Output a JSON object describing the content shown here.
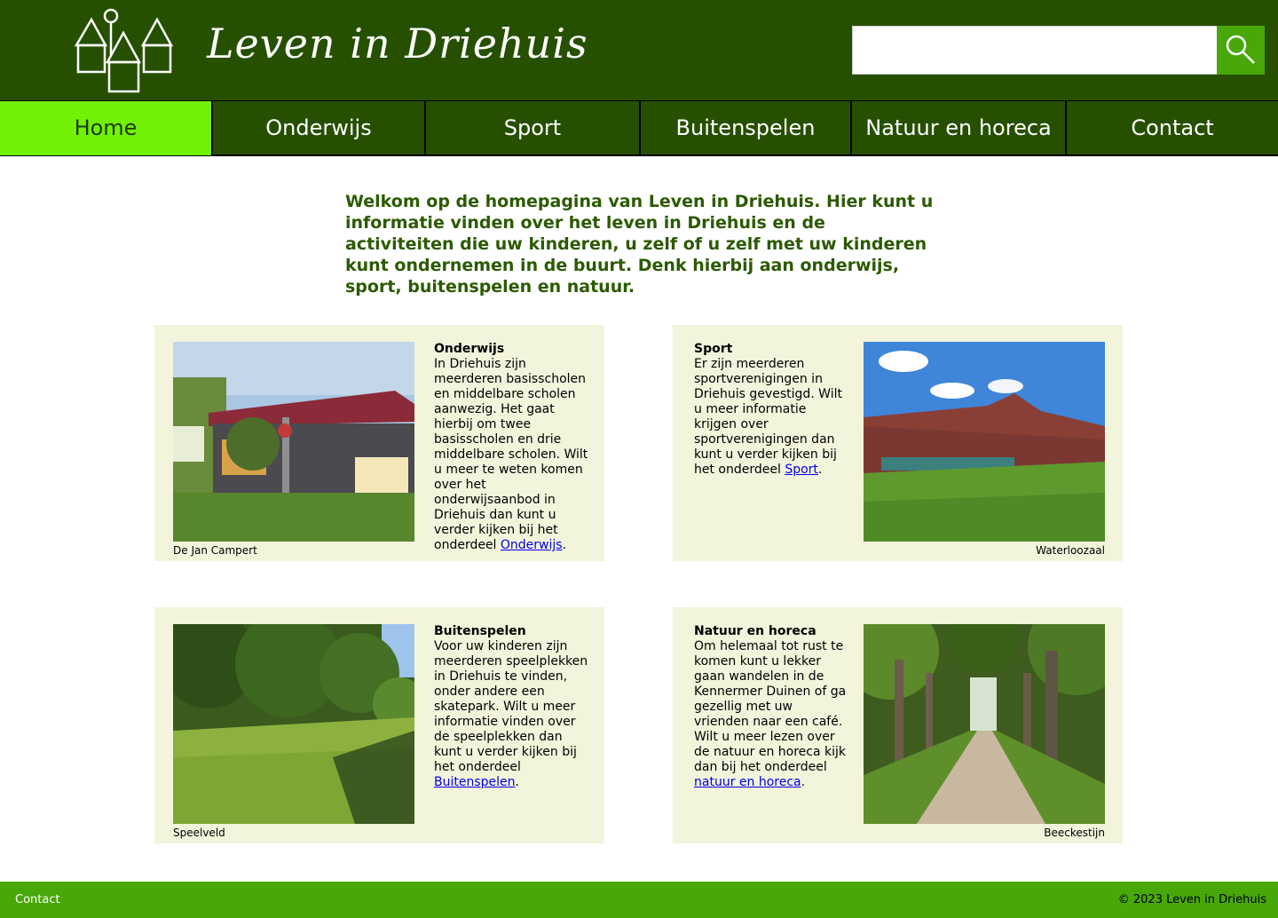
{
  "header": {
    "title": "Leven in Driehuis",
    "search_placeholder": ""
  },
  "nav": {
    "items": [
      "Home",
      "Onderwijs",
      "Sport",
      "Buitenspelen",
      "Natuur en horeca",
      "Contact"
    ],
    "active": "Home"
  },
  "intro": "Welkom op de homepagina van Leven in Driehuis. Hier kunt u informatie vinden over het leven in Driehuis en de activiteiten die uw kinderen, u zelf of u zelf met uw kinderen kunt ondernemen in de buurt. Denk hierbij aan onderwijs, sport, buitenspelen en natuur.",
  "cards": [
    {
      "heading": "Onderwijs",
      "body": "In Driehuis zijn meerderen basisscholen en middelbare scholen aanwezig. Het gaat hierbij om twee basisscholen en drie middelbare scholen. Wilt u meer te weten komen over het onderwijsaanbod in Driehuis dan kunt u verder kijken bij het onderdeel ",
      "link": "Onderwijs",
      "end": ".",
      "caption": "De Jan Campert"
    },
    {
      "heading": "Sport",
      "body": "Er zijn meerderen sportverenigingen in Driehuis gevestigd. Wilt u meer informatie krijgen over sportverenigingen dan kunt u verder kijken bij het onderdeel ",
      "link": "Sport",
      "end": ".",
      "caption": "Waterloozaal"
    },
    {
      "heading": "Buitenspelen",
      "body": "Voor uw kinderen zijn meerderen speelplekken in Driehuis te vinden, onder andere een skatepark. Wilt u meer informatie vinden over de speelplekken dan kunt u verder kijken bij het onderdeel ",
      "link": "Buitenspelen",
      "end": ".",
      "caption": "Speelveld"
    },
    {
      "heading": "Natuur en horeca",
      "body": "Om helemaal tot rust te komen kunt u lekker gaan wandelen in de Kennermer Duinen of ga gezellig met uw vrienden naar een café. Wilt u meer lezen over de natuur en horeca kijk dan bij het onderdeel ",
      "link": "natuur en horeca",
      "end": ".",
      "caption": "Beeckestijn"
    }
  ],
  "footer": {
    "contact": "Contact",
    "copyright": "© 2023 Leven in Driehuis"
  },
  "colors": {
    "header_bg": "#265000",
    "nav_active": "#72f107",
    "search_button": "#48a80a",
    "card_bg": "#f2f4dc",
    "footer_bg": "#48a80a",
    "intro_text": "#2b5a00"
  }
}
